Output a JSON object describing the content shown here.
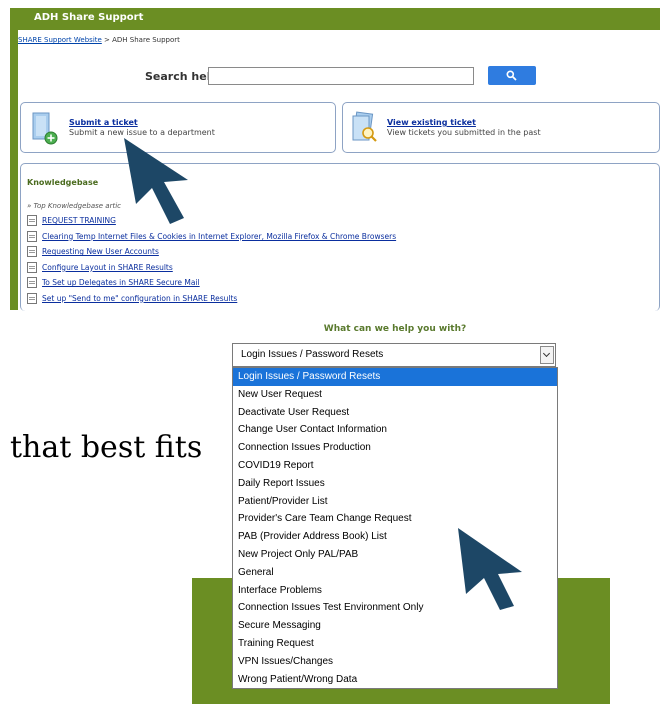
{
  "portal": {
    "title": "ADH Share Support",
    "breadcrumb_link": "SHARE Support Website",
    "breadcrumb_current": " > ADH Share Support",
    "search_label": "Search help:",
    "search_value": "",
    "cards": [
      {
        "title": "Submit a ticket",
        "desc": "Submit a new issue to a department"
      },
      {
        "title": "View existing ticket",
        "desc": "View tickets you submitted in the past"
      }
    ],
    "kb": {
      "title": "Knowledgebase",
      "subtitle": "» Top Knowledgebase artic",
      "articles": [
        "REQUEST TRAINING",
        "Clearing Temp Internet Files & Cookies in Internet Explorer, Mozilla Firefox & Chrome Browsers",
        "Requesting New User Accounts",
        "Configure Layout in SHARE Results",
        "To Set up Delegates in SHARE Secure Mail",
        "Set up \"Send to me\" configuration in SHARE Results"
      ]
    }
  },
  "side_text": "that best fits",
  "dropdown": {
    "question": "What can we help you with?",
    "selected": "Login Issues / Password Resets",
    "options": [
      "Login Issues / Password Resets",
      "New User Request",
      "Deactivate User Request",
      "Change User Contact Information",
      "Connection Issues Production",
      "COVID19 Report",
      "Daily Report Issues",
      "Patient/Provider List",
      "Provider's Care Team Change Request",
      "PAB (Provider Address Book) List",
      "New Project Only PAL/PAB",
      "General",
      "Interface Problems",
      "Connection Issues Test Environment Only",
      "Secure Messaging",
      "Training Request",
      "VPN Issues/Changes",
      "Wrong Patient/Wrong Data"
    ]
  },
  "colors": {
    "brand_green": "#6b8e23",
    "link_blue": "#0a2e9e",
    "select_blue": "#1a73d9",
    "cursor": "#1d4766"
  }
}
